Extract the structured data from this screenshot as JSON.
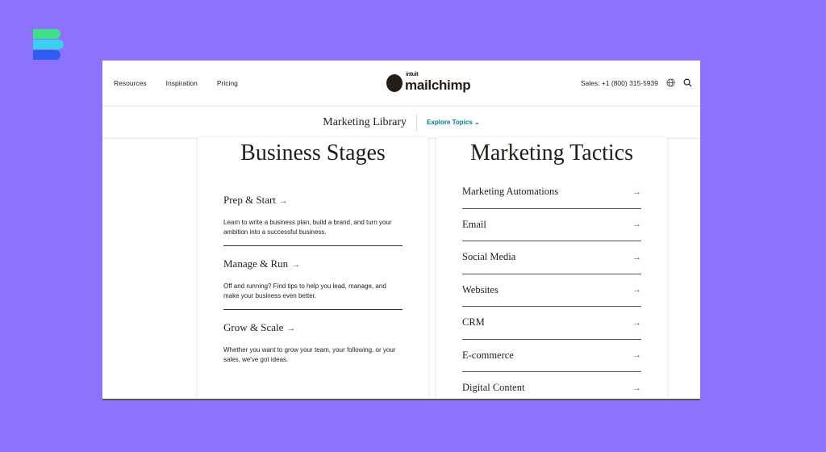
{
  "brand_colors": {
    "green": "#3fe08a",
    "cyan": "#3ad0f0",
    "blue": "#2f5cf5",
    "accent": "#007c89"
  },
  "header": {
    "nav": [
      "Resources",
      "Inspiration",
      "Pricing"
    ],
    "logo_small": "intuit",
    "logo": "mailchimp",
    "sales": "Sales: +1 (800) 315-5939",
    "icons": [
      "globe-icon",
      "search-icon"
    ]
  },
  "subnav": {
    "title": "Marketing Library",
    "explore": "Explore Topics"
  },
  "stages": {
    "title": "Business Stages",
    "items": [
      {
        "title": "Prep & Start",
        "desc": "Learn to write a business plan, build a brand, and turn your ambition into a successful business."
      },
      {
        "title": "Manage & Run",
        "desc": "Off and running? Find tips to help you lead, manage, and make your business even better."
      },
      {
        "title": "Grow & Scale",
        "desc": "Whether you want to grow your team, your following, or your sales, we've got ideas."
      }
    ]
  },
  "tactics": {
    "title": "Marketing Tactics",
    "items": [
      "Marketing Automations",
      "Email",
      "Social Media",
      "Websites",
      "CRM",
      "E-commerce",
      "Digital Content"
    ]
  },
  "arrow": "→"
}
